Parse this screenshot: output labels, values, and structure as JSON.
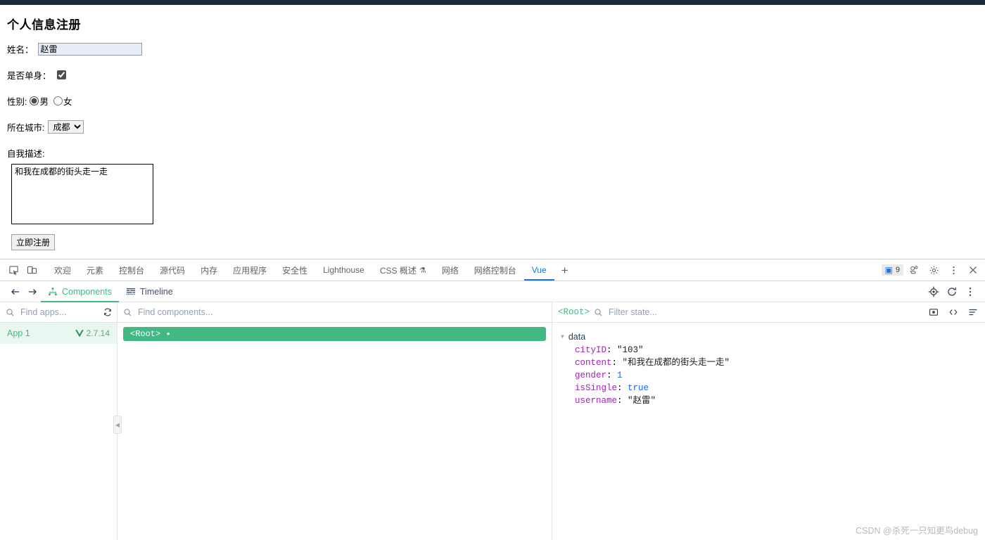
{
  "form": {
    "title": "个人信息注册",
    "name_label": "姓名：",
    "name_value": "赵雷",
    "single_label": "是否单身：",
    "single_checked": true,
    "gender_label": "性别:",
    "gender_male": "男",
    "gender_female": "女",
    "city_label": "所在城市:",
    "city_selected": "成都",
    "city_options": [
      "成都"
    ],
    "desc_label": "自我描述:",
    "desc_value": "和我在成都的街头走一走",
    "submit_label": "立即注册"
  },
  "devtools": {
    "inspect_icon": "inspect-element-icon",
    "device_icon": "device-toolbar-icon",
    "tabs": [
      {
        "label": "欢迎",
        "active": false
      },
      {
        "label": "元素",
        "active": false
      },
      {
        "label": "控制台",
        "active": false
      },
      {
        "label": "源代码",
        "active": false
      },
      {
        "label": "内存",
        "active": false
      },
      {
        "label": "应用程序",
        "active": false
      },
      {
        "label": "安全性",
        "active": false
      },
      {
        "label": "Lighthouse",
        "active": false
      },
      {
        "label": "CSS 概述",
        "active": false,
        "flask": true
      },
      {
        "label": "网络",
        "active": false
      },
      {
        "label": "网络控制台",
        "active": false
      },
      {
        "label": "Vue",
        "active": true
      }
    ],
    "add_tab_label": "+",
    "message_count": "9",
    "right_icons": [
      "message-badge-icon",
      "vue-devtools-icon",
      "gear-icon",
      "kebab-menu-icon",
      "close-icon"
    ]
  },
  "vue": {
    "back_label": "←",
    "forward_label": "→",
    "panels": [
      {
        "label": "Components",
        "active": true,
        "icon": "component-tree-icon"
      },
      {
        "label": "Timeline",
        "active": false,
        "icon": "timeline-icon"
      }
    ],
    "toolbar_icons": [
      "target-select-icon",
      "refresh-icon",
      "kebab-menu-icon"
    ],
    "apps": {
      "search_placeholder": "Find apps...",
      "refresh_icon": "refresh-apps-icon",
      "items": [
        {
          "name": "App 1",
          "version": "2.7.14",
          "icon": "vue-logo-icon",
          "selected": true
        }
      ]
    },
    "tree": {
      "search_placeholder": "Find components...",
      "nodes": [
        {
          "label": "<Root>",
          "marker": "•",
          "selected": true
        }
      ],
      "collapse_handle": "◀"
    },
    "state": {
      "root_label": "<Root>",
      "filter_placeholder": "Filter state...",
      "icons": [
        "pick-element-icon",
        "open-in-editor-icon",
        "list-options-icon"
      ],
      "groups": [
        {
          "name": "data",
          "expanded": true,
          "entries": [
            {
              "key": "cityID",
              "value": "\"103\"",
              "type": "string"
            },
            {
              "key": "content",
              "value": "\"和我在成都的街头走一走\"",
              "type": "string"
            },
            {
              "key": "gender",
              "value": "1",
              "type": "number"
            },
            {
              "key": "isSingle",
              "value": "true",
              "type": "boolean"
            },
            {
              "key": "username",
              "value": "\"赵雷\"",
              "type": "string"
            }
          ]
        }
      ]
    }
  },
  "watermark": "CSDN @杀死一只知更鸟debug",
  "colors": {
    "vue_green": "#42b883",
    "chrome_blue": "#1a73e8",
    "key_purple": "#9c27b0",
    "value_blue": "#1565f0",
    "top_strip": "#1b2a38"
  }
}
